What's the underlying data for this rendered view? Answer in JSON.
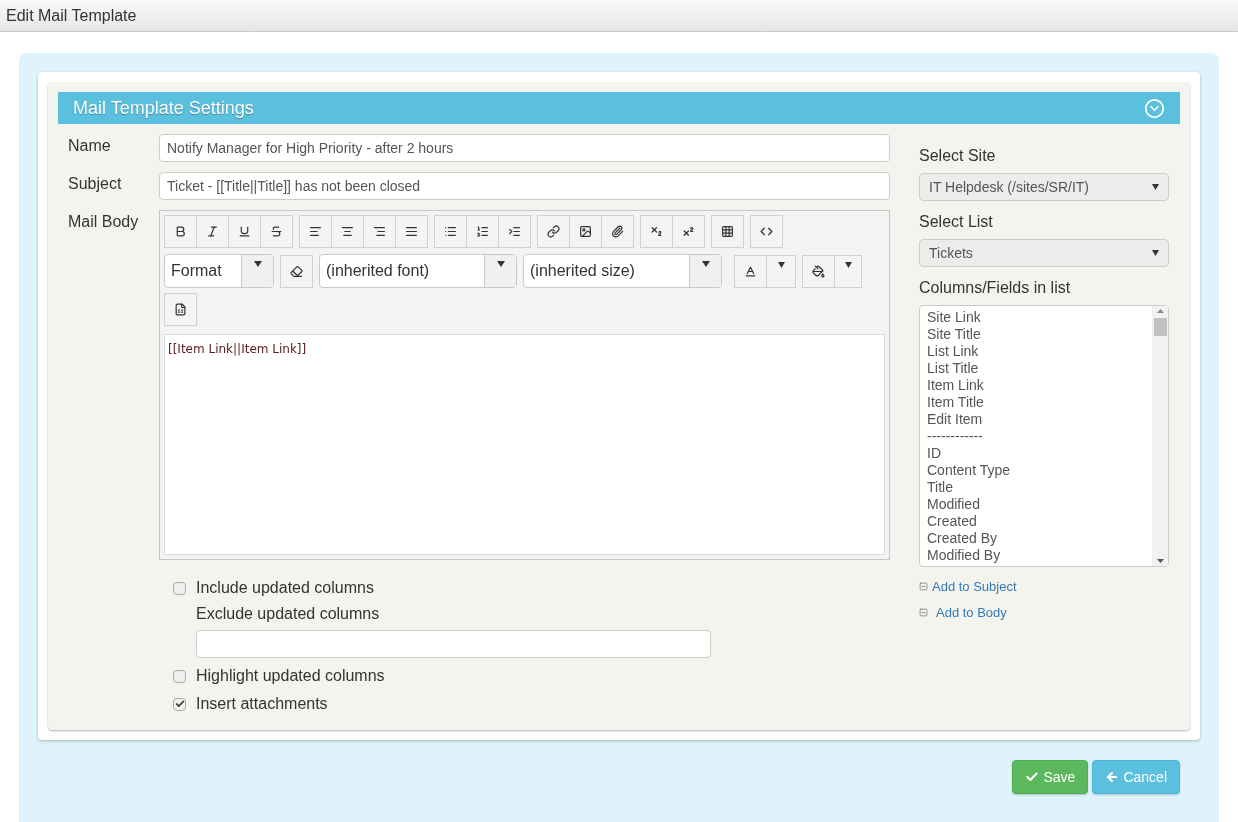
{
  "page_title": "Edit Mail Template",
  "panel": {
    "title": "Mail Template Settings"
  },
  "fields": [
    {
      "label": "Name",
      "value": "Notify Manager for High Priority - after 2 hours"
    },
    {
      "label": "Subject",
      "value": "Ticket - [[Title||Title]] has not been closed"
    }
  ],
  "mail_body": {
    "label": "Mail Body",
    "format": "Format",
    "font": "(inherited font)",
    "size": "(inherited size)",
    "content": "[[Item Link||Item Link]]"
  },
  "options": [
    {
      "kind": "checkbox",
      "label": "Include updated columns",
      "checked": false
    },
    {
      "kind": "text",
      "label": "Exclude updated columns"
    },
    {
      "kind": "checkbox",
      "label": "Highlight updated columns",
      "checked": false
    },
    {
      "kind": "checkbox",
      "label": "Insert attachments",
      "checked": true
    }
  ],
  "site": {
    "label": "Select Site",
    "value": "IT Helpdesk (/sites/SR/IT)"
  },
  "list": {
    "label": "Select List",
    "value": "Tickets"
  },
  "columns": {
    "label": "Columns/Fields in list",
    "items": [
      "Site Link",
      "Site Title",
      "List Link",
      "List Title",
      "Item Link",
      "Item Title",
      "Edit Item",
      "------------",
      "ID",
      "Content Type",
      "Title",
      "Modified",
      "Created",
      "Created By",
      "Modified By"
    ]
  },
  "links": [
    "Add to Subject",
    "Add to Body"
  ],
  "buttons": [
    {
      "kind": "save",
      "label": "Save"
    },
    {
      "kind": "cancel",
      "label": "Cancel"
    }
  ]
}
